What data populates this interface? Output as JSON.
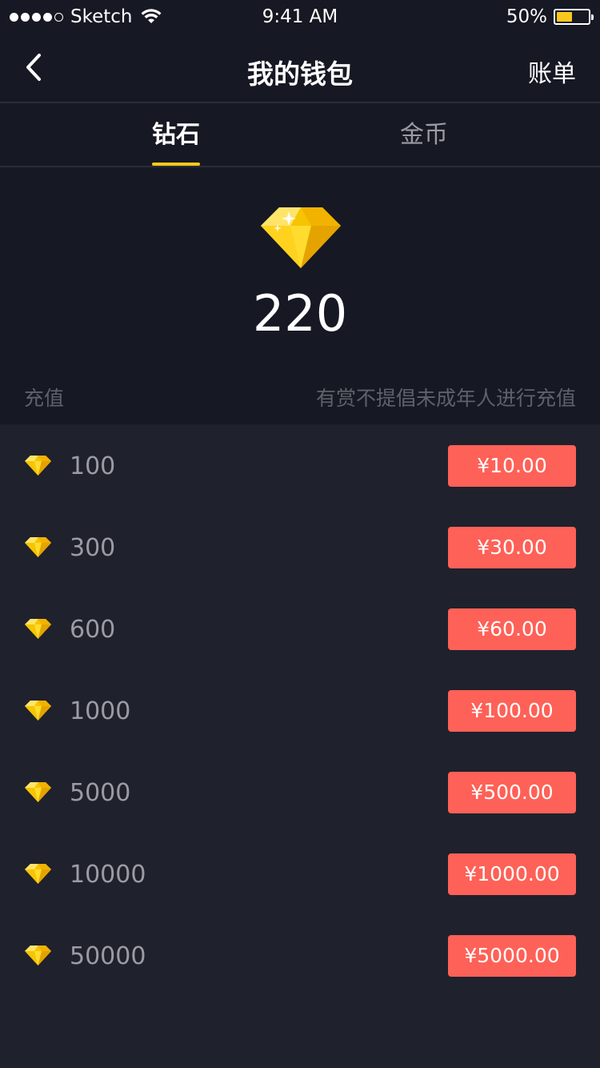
{
  "status_bar": {
    "carrier": "Sketch",
    "time": "9:41 AM",
    "battery_percent": "50%",
    "battery_level": 0.5,
    "signal_bars_filled": 4,
    "signal_bars_total": 5
  },
  "nav": {
    "title": "我的钱包",
    "right_action": "账单",
    "back_icon": "chevron-left-icon"
  },
  "tabs": [
    {
      "label": "钻石",
      "active": true
    },
    {
      "label": "金币",
      "active": false
    }
  ],
  "accent_color": "#f8c81c",
  "button_color": "#fe6157",
  "balance": {
    "icon": "diamond-icon",
    "value": "220"
  },
  "recharge": {
    "label": "充值",
    "notice": "有赏不提倡未成年人进行充值"
  },
  "packages": [
    {
      "amount": "100",
      "price": "¥10.00"
    },
    {
      "amount": "300",
      "price": "¥30.00"
    },
    {
      "amount": "600",
      "price": "¥60.00"
    },
    {
      "amount": "1000",
      "price": "¥100.00"
    },
    {
      "amount": "5000",
      "price": "¥500.00"
    },
    {
      "amount": "10000",
      "price": "¥1000.00"
    },
    {
      "amount": "50000",
      "price": "¥5000.00"
    }
  ]
}
